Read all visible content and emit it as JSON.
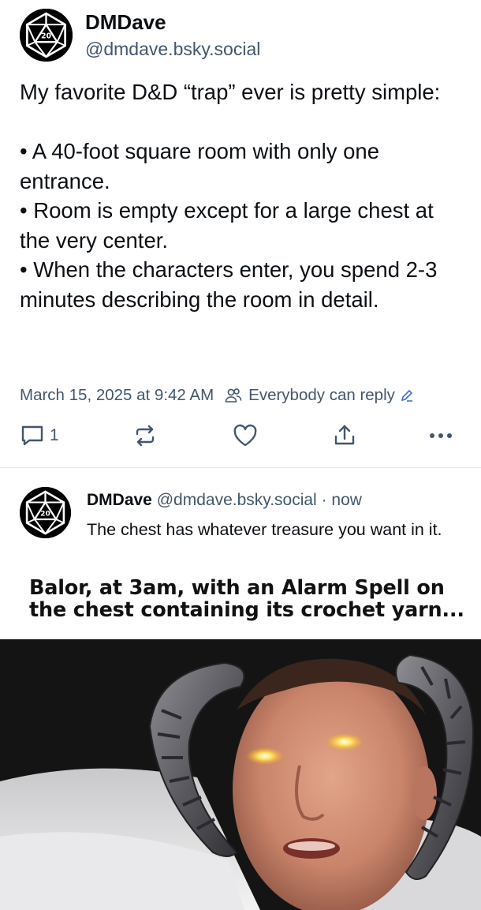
{
  "post": {
    "author_name": "DMDave",
    "author_handle": "@dmdave.bsky.social",
    "body_lines": [
      "My favorite D&D “trap” ever is pretty simple:",
      "",
      "• A 40-foot square room with only one entrance.",
      "• Room is empty except for a large chest at the very center.",
      "• When the characters enter, you spend 2-3 minutes describing the room in detail."
    ],
    "timestamp": "March 15, 2025 at 9:42 AM",
    "reply_setting": "Everybody can reply",
    "reply_count": "1",
    "icons": {
      "avatar": "d20-dice-icon",
      "reply": "speech-bubble-icon",
      "repost": "repost-arrows-icon",
      "like": "heart-icon",
      "share": "share-upload-icon",
      "more": "more-dots-icon",
      "people": "people-icon",
      "edit": "pencil-icon"
    }
  },
  "reply": {
    "author_name": "DMDave",
    "author_handle": "@dmdave.bsky.social",
    "time": "· now",
    "text": "The chest has whatever treasure you want in it."
  },
  "meme": {
    "caption": "Balor, at 3am, with an Alarm Spell on the chest containing its crochet yarn..."
  },
  "colors": {
    "text": "#0b0f14",
    "muted": "#42576c",
    "divider": "#e4e8ee",
    "eye_glow": "#ffd21a"
  }
}
